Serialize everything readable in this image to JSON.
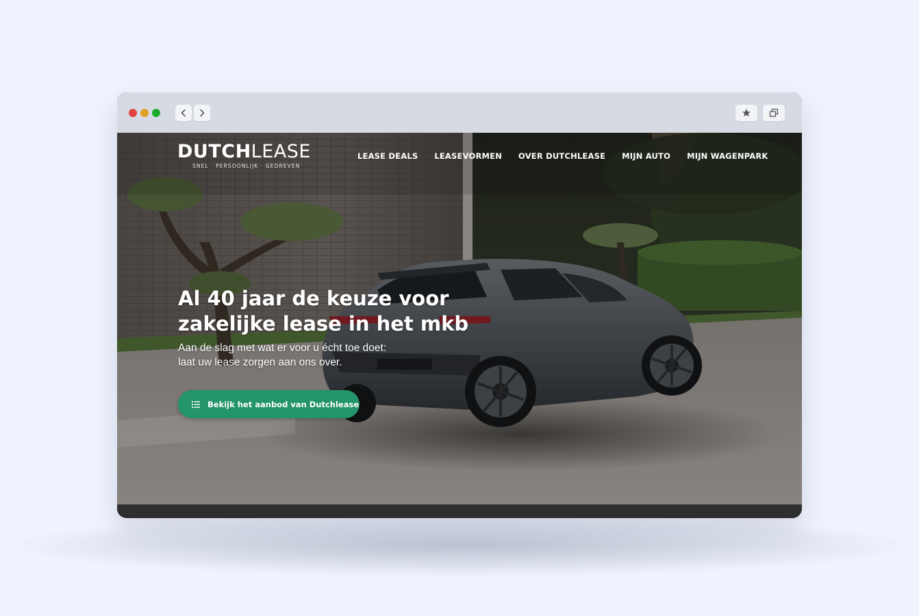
{
  "browser": {
    "controls": {
      "back_icon": "chevron-left-icon",
      "forward_icon": "chevron-right-icon",
      "bookmark_icon": "star-icon",
      "window_icon": "window-restore-icon"
    }
  },
  "site": {
    "logo": {
      "bold": "DUTCH",
      "light": "LEASE",
      "tagline": "SNEL · PERSOONLIJK · GEDREVEN"
    },
    "nav": [
      {
        "label": "LEASE DEALS"
      },
      {
        "label": "LEASEVORMEN"
      },
      {
        "label": "OVER DUTCHLEASE"
      },
      {
        "label": "MIJN AUTO"
      },
      {
        "label": "MIJN WAGENPARK"
      }
    ],
    "hero": {
      "title_line1": "Al 40 jaar de keuze voor",
      "title_line2": "zakelijke lease in het mkb",
      "subtitle_line1": "Aan de slag met wat er voor u écht toe doet:",
      "subtitle_line2": "laat uw lease zorgen aan ons over.",
      "cta_label": "Bekijk het aanbod van Dutchlease",
      "cta_icon": "list-icon"
    }
  },
  "colors": {
    "page_bg": "#eff3fd",
    "chrome_bg": "#d6dae3",
    "cta_green": "#24946a",
    "bottom_bar": "#2e2e30"
  }
}
